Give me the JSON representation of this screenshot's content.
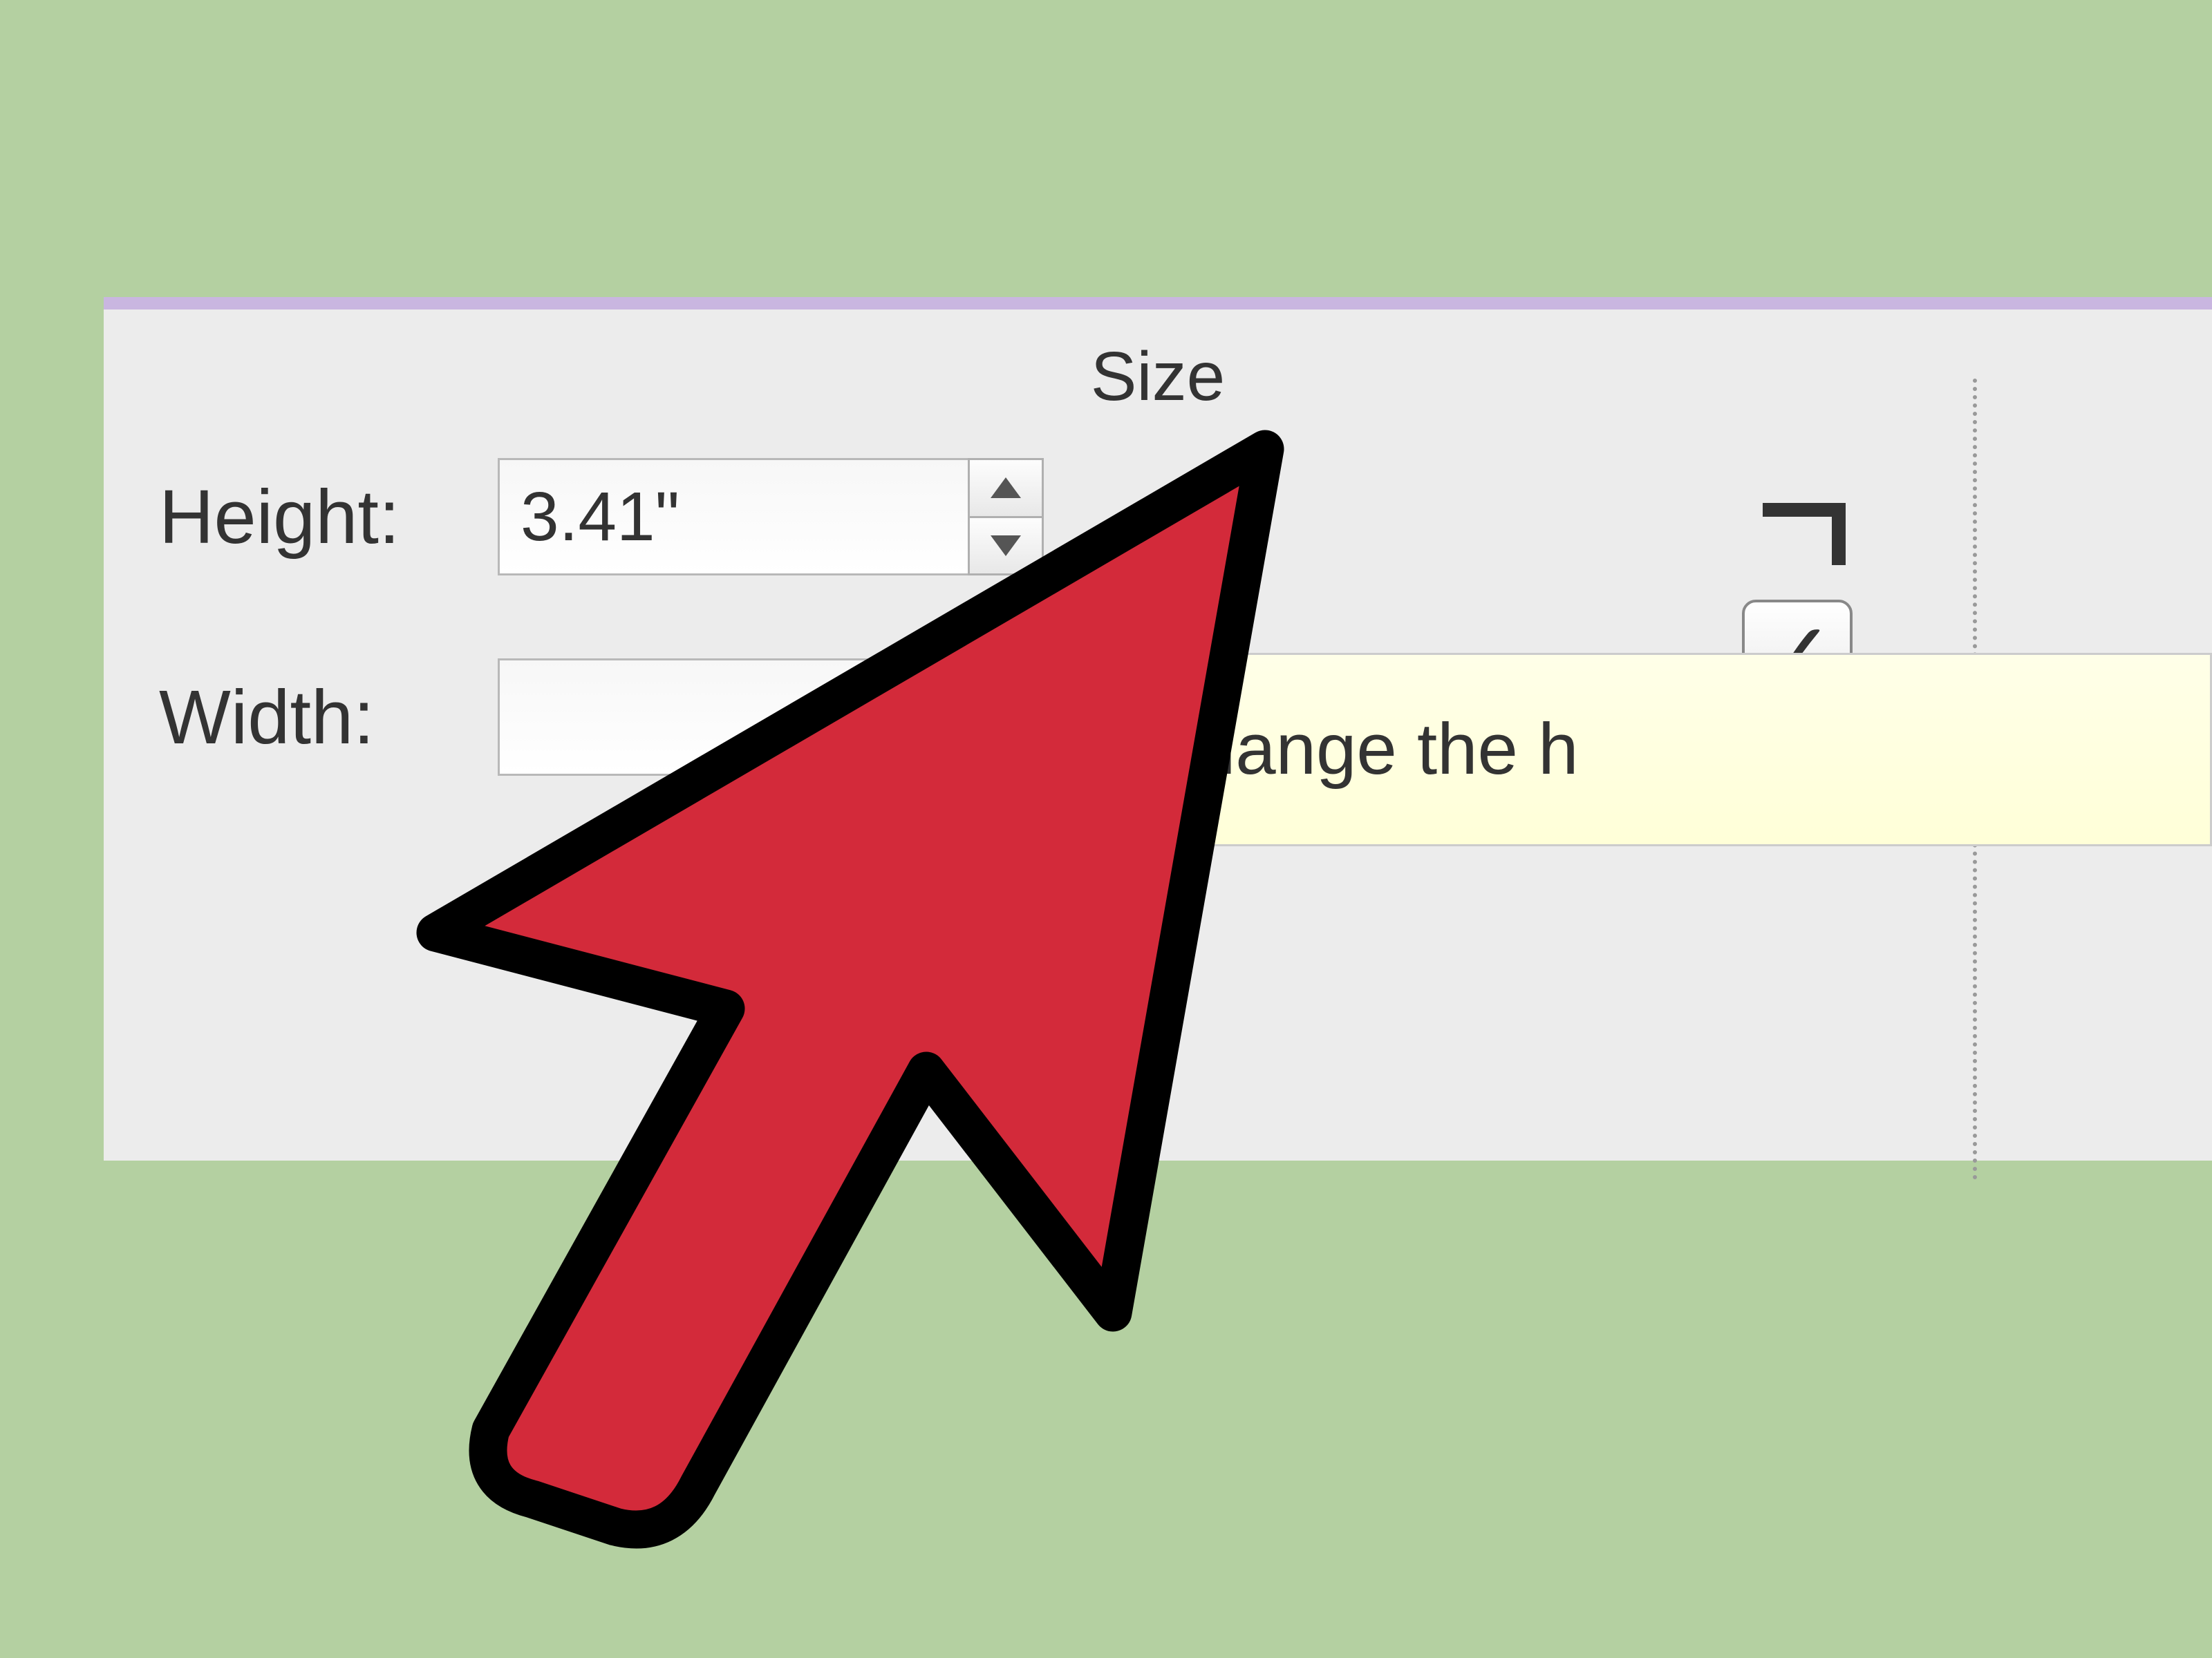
{
  "panel": {
    "title": "Size",
    "height_label": "Height:",
    "height_value": "3.41\"",
    "width_label": "Width:",
    "width_value": ""
  },
  "checkbox": {
    "checked": true,
    "checkmark_glyph": "✓"
  },
  "tooltip": {
    "text": "Change the h"
  },
  "colors": {
    "background": "#b4d0a1",
    "panel_bg": "#ececec",
    "accent_bar": "#c9b6e0",
    "cursor_fill": "#d32a3a",
    "cursor_stroke": "#000000"
  }
}
